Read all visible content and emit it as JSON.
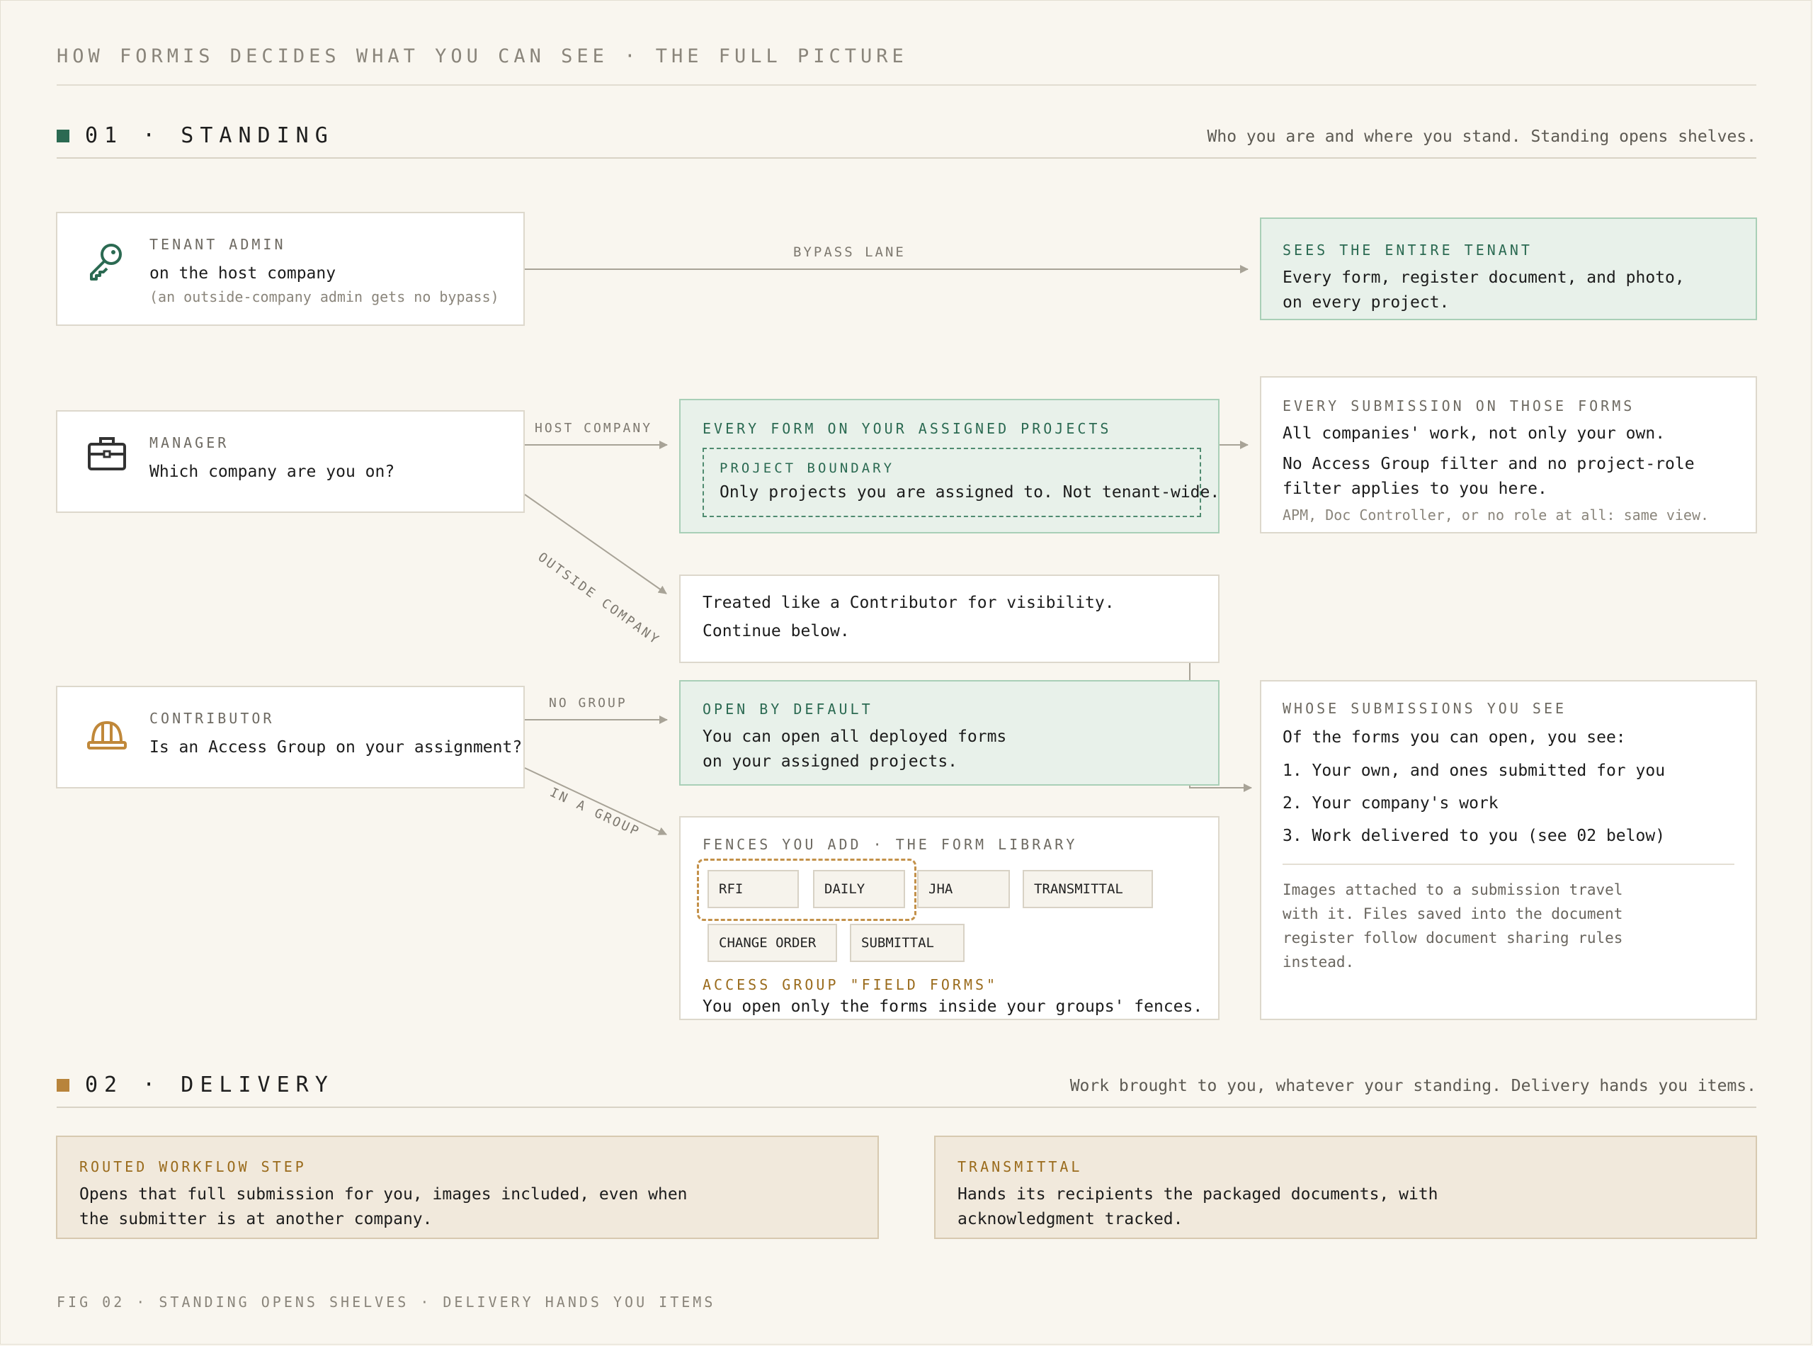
{
  "title": "HOW FORMIS DECIDES WHAT YOU CAN SEE · THE FULL PICTURE",
  "colors": {
    "green": "#2b6a52",
    "amber": "#b8843b",
    "background": "#f9f6ef"
  },
  "sections": {
    "standing": {
      "heading": "01 · STANDING",
      "note": "Who you are and where you stand. Standing opens shelves."
    },
    "delivery": {
      "heading": "02 · DELIVERY",
      "note": "Work brought to you, whatever your standing. Delivery hands you items."
    }
  },
  "roles": {
    "tenant_admin": {
      "icon": "key-icon",
      "label": "TENANT ADMIN",
      "line": "on the host company",
      "sub": "(an outside-company admin gets no bypass)"
    },
    "manager": {
      "icon": "briefcase-icon",
      "label": "MANAGER",
      "line": "Which company are you on?"
    },
    "contributor": {
      "icon": "hardhat-icon",
      "label": "CONTRIBUTOR",
      "line": "Is an Access Group on your assignment?"
    }
  },
  "edges": {
    "bypass": "BYPASS LANE",
    "host_company": "HOST COMPANY",
    "outside_company": "OUTSIDE COMPANY",
    "no_group": "NO GROUP",
    "in_a_group": "IN A GROUP"
  },
  "tenant_result": {
    "label": "SEES THE ENTIRE TENANT",
    "line1": "Every form, register document, and photo,",
    "line2": "on every project."
  },
  "assigned_projects": {
    "label": "EVERY FORM ON YOUR ASSIGNED PROJECTS",
    "boundary_label": "PROJECT BOUNDARY",
    "boundary_text": "Only projects you are assigned to. Not tenant-wide."
  },
  "every_submission": {
    "label": "EVERY SUBMISSION ON THOSE FORMS",
    "line1": "All companies' work, not only your own.",
    "line2": "No Access Group filter and no project-role",
    "line3": "filter applies to you here.",
    "note": "APM, Doc Controller, or no role at all: same view."
  },
  "treated": {
    "line1": "Treated like a Contributor for visibility.",
    "line2": "Continue below."
  },
  "open_default": {
    "label": "OPEN BY DEFAULT",
    "line1": "You can open all deployed forms",
    "line2": "on your assigned projects."
  },
  "fences": {
    "label": "FENCES YOU ADD · THE FORM LIBRARY",
    "chips": [
      "RFI",
      "DAILY",
      "JHA",
      "TRANSMITTAL",
      "CHANGE ORDER",
      "SUBMITTAL"
    ],
    "group_label": "ACCESS GROUP \"FIELD FORMS\"",
    "group_text": "You open only the forms inside your groups' fences."
  },
  "whose": {
    "label": "WHOSE SUBMISSIONS YOU SEE",
    "intro": "Of the forms you can open, you see:",
    "items": [
      "1. Your own, and ones submitted for you",
      "2. Your company's work",
      "3. Work delivered to you (see 02 below)"
    ],
    "note_lines": [
      "Images attached to a submission travel",
      "with it. Files saved into the document",
      "register follow document sharing rules",
      "instead."
    ]
  },
  "delivery_cards": {
    "routed": {
      "label": "ROUTED WORKFLOW STEP",
      "line1": "Opens that full submission for you, images included, even when",
      "line2": "the submitter is at another company."
    },
    "transmittal": {
      "label": "TRANSMITTAL",
      "line1": "Hands its recipients the packaged documents, with",
      "line2": "acknowledgment tracked."
    }
  },
  "footer": "FIG 02 · STANDING OPENS SHELVES · DELIVERY HANDS YOU ITEMS"
}
